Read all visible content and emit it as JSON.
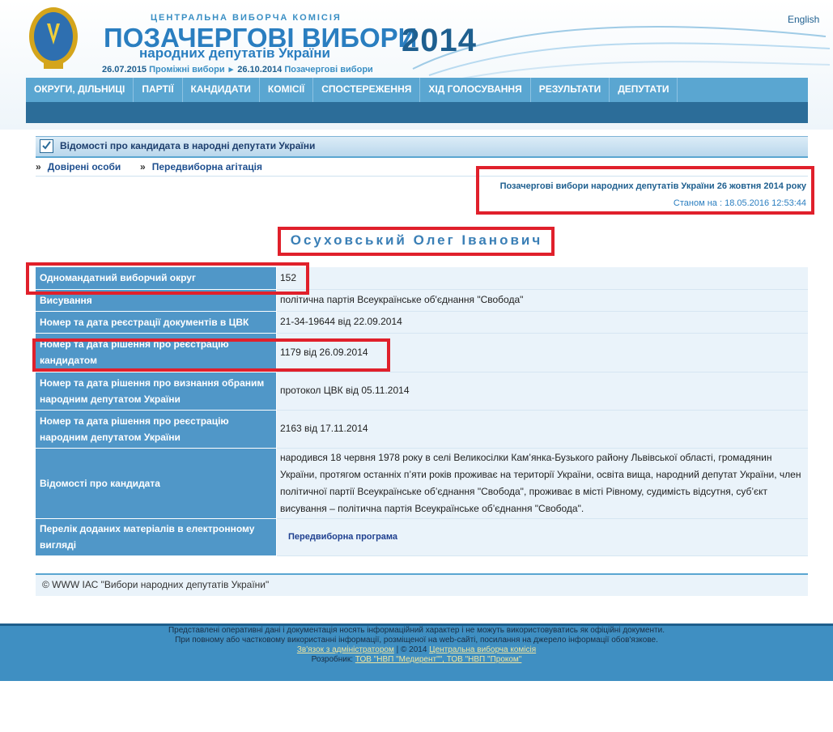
{
  "header": {
    "org": "ЦЕНТРАЛЬНА ВИБОРЧА КОМІСІЯ",
    "title": "ПОЗАЧЕРГОВІ ВИБОРИ",
    "subtitle": "народних депутатів України",
    "year": "2014",
    "date1": "26.07.2015",
    "label1": "Проміжні вибори",
    "date2": "26.10.2014",
    "label2": "Позачергові вибори",
    "language_link": "English"
  },
  "nav": {
    "items": [
      "ОКРУГИ, ДІЛЬНИЦІ",
      "ПАРТІЇ",
      "КАНДИДАТИ",
      "КОМІСІЇ",
      "СПОСТЕРЕЖЕННЯ",
      "ХІД ГОЛОСУВАННЯ",
      "РЕЗУЛЬТАТИ",
      "ДЕПУТАТИ"
    ]
  },
  "section": {
    "title": "Відомості про кандидата в народні депутати України",
    "link_trustees": "Довірені особи",
    "link_campaign": "Передвиборна агітація",
    "election_title": "Позачергові вибори народних депутатів України 26 жовтня 2014 року",
    "as_of": "Станом на : 18.05.2016 12:53:44"
  },
  "candidate": {
    "name": "Осуховський Олег Іванович",
    "rows": [
      {
        "key": "Одномандатний виборчий округ",
        "value": "152"
      },
      {
        "key": "Висування",
        "value": "політична партія Всеукраїнське об'єднання \"Свобода\""
      },
      {
        "key": "Номер та дата реєстрації документів в ЦВК",
        "value": "21-34-19644 від 22.09.2014"
      },
      {
        "key": "Номер та дата рішення про реєстрацію кандидатом",
        "value": "1179 від 26.09.2014"
      },
      {
        "key": "Номер та дата рішення про визнання обраним народним депутатом України",
        "value": "протокол ЦВК від 05.11.2014"
      },
      {
        "key": "Номер та дата рішення про реєстрацію народним депутатом України",
        "value": "2163 від 17.11.2014"
      },
      {
        "key": "Відомості про кандидата",
        "value": "народився 18 червня 1978 року в селі Великосілки Кам’янка-Бузького району Львівської області, громадянин України, протягом останніх п’яти років проживає на території України, освіта вища, народний депутат України, член політичної партії Всеукраїнське об’єднання \"Свобода\", проживає в місті Рівному, судимість відсутня, суб’єкт висування – політична партія Всеукраїнське об’єднання \"Свобода\"."
      },
      {
        "key": "Перелік доданих матеріалів в електронному вигляді",
        "value": "Передвиборна програма"
      }
    ]
  },
  "copyright": "© WWW ІАС \"Вибори народних депутатів України\"",
  "footer": {
    "line1": "Представлені оперативні дані і документація носять інформаційний характер і не можуть використовуватись як офіційні документи.",
    "line2": "При повному або частковому використанні інформації, розміщеної на web-сайті, посилання на джерело інформації обов'язкове.",
    "contact_link": "Зв'язок з адміністратором",
    "copy": " | © 2014 ",
    "cvk_link": "Центральна виборча комісія",
    "dev_label": "Розробник: ",
    "dev_link": "ТОВ \"НВП \"Медирент\"\", ТОВ \"НВП \"Проком\""
  }
}
